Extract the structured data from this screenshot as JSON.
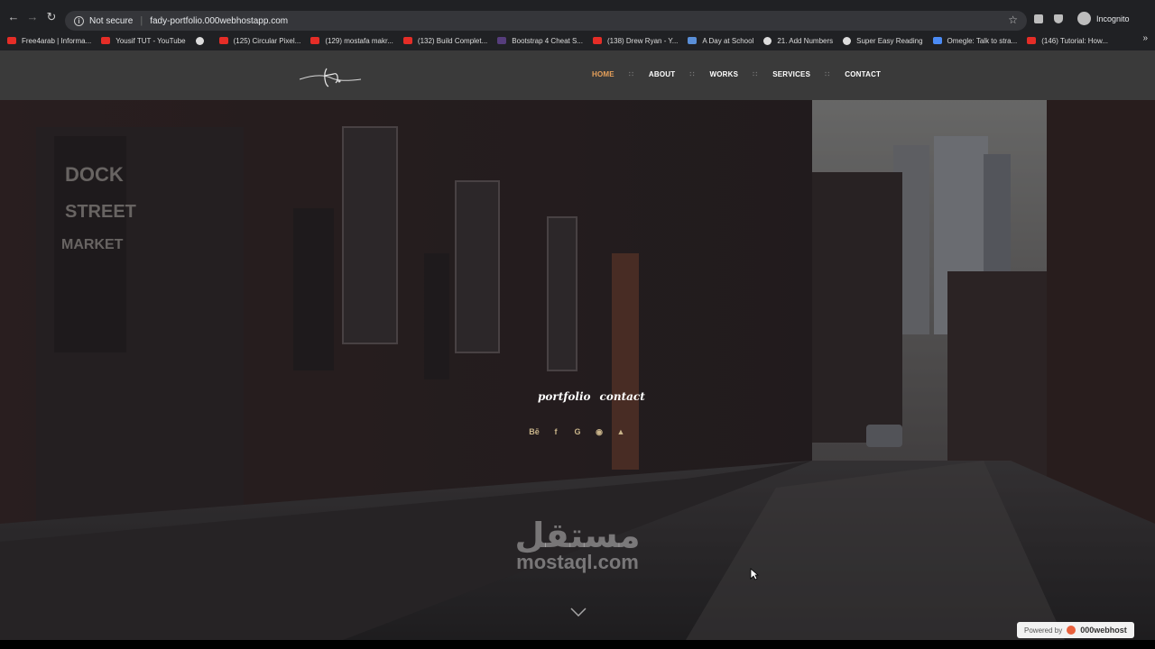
{
  "browser": {
    "nav": {
      "back": "←",
      "forward": "→",
      "reload": "↻"
    },
    "address": {
      "security_label": "Not secure",
      "url": "fady-portfolio.000webhostapp.com"
    },
    "profile_label": "Incognito",
    "bookmarks": [
      {
        "label": "Free4arab | Informa...",
        "favicon": "youtube-icon"
      },
      {
        "label": "Yousif TUT - YouTube",
        "favicon": "youtube-icon"
      },
      {
        "label": "",
        "favicon": "globe-icon"
      },
      {
        "label": "(125) Circular Pixel...",
        "favicon": "youtube-icon"
      },
      {
        "label": "(129) mostafa makr...",
        "favicon": "youtube-icon"
      },
      {
        "label": "(132) Build Complet...",
        "favicon": "youtube-icon"
      },
      {
        "label": "Bootstrap 4 Cheat S...",
        "favicon": "h-icon"
      },
      {
        "label": "(138) Drew Ryan - Y...",
        "favicon": "youtube-icon"
      },
      {
        "label": "A Day at School",
        "favicon": "image-icon"
      },
      {
        "label": "21. Add Numbers",
        "favicon": "globe-icon"
      },
      {
        "label": "Super Easy Reading",
        "favicon": "globe-icon"
      },
      {
        "label": "Omegle: Talk to stra...",
        "favicon": "omegle-icon"
      },
      {
        "label": "(146) Tutorial: How...",
        "favicon": "youtube-icon"
      }
    ],
    "bookmarks_more": "»"
  },
  "site": {
    "nav": [
      {
        "label": "HOME",
        "active": true
      },
      {
        "label": "ABOUT",
        "active": false
      },
      {
        "label": "WORKS",
        "active": false
      },
      {
        "label": "SERVICES",
        "active": false
      },
      {
        "label": "CONTACT",
        "active": false
      }
    ],
    "hero": {
      "links": {
        "portfolio": "portfolio",
        "contact": "contact"
      },
      "socials": [
        {
          "icon": "behance-icon",
          "glyph": "Bē"
        },
        {
          "icon": "facebook-icon",
          "glyph": "f"
        },
        {
          "icon": "google-icon",
          "glyph": "G"
        },
        {
          "icon": "github-icon",
          "glyph": "◉"
        },
        {
          "icon": "user-icon",
          "glyph": "▲"
        }
      ]
    },
    "watermark": {
      "arabic": "مستقل",
      "latin": "mostaql.com"
    },
    "powered_by": {
      "prefix": "Powered by",
      "brand": "000webhost"
    }
  },
  "colors": {
    "accent": "#e6a05a",
    "header_bg": "#3a3a3a",
    "chrome_bg": "#202124"
  }
}
